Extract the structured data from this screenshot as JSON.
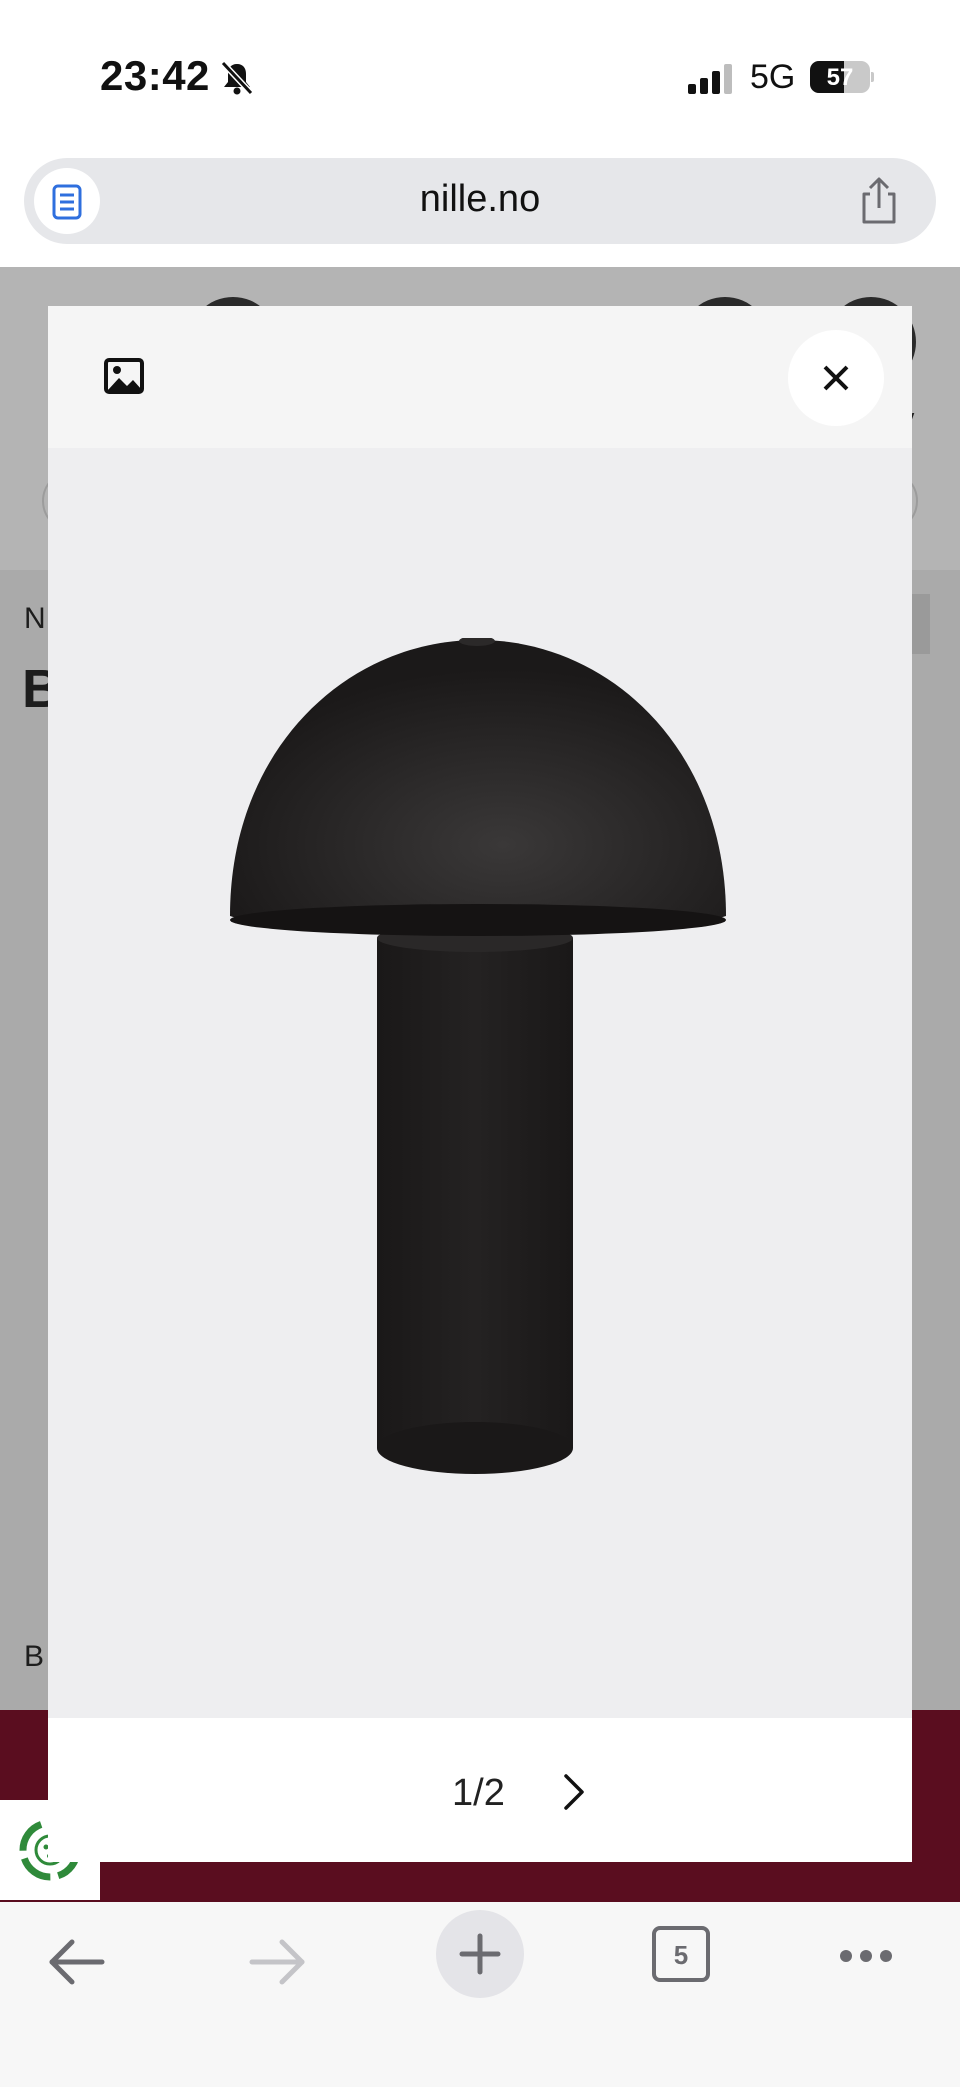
{
  "status_bar": {
    "time": "23:42",
    "network": "5G",
    "battery": "57",
    "battery_level": 0.57
  },
  "browser": {
    "url": "nille.no",
    "tab_count": "5"
  },
  "background_page": {
    "crumb_fragment": "N",
    "title_fragment": "B",
    "text_fragment": "B",
    "nav_label_fragment": "rv"
  },
  "modal": {
    "pager": "1/2"
  },
  "colors": {
    "footer_band": "#5a0d1f",
    "eco_green": "#2f8a3a",
    "lamp": "#1e1c1c"
  },
  "icons": {
    "reader": "reader-icon",
    "share": "share-icon",
    "image": "image-icon",
    "close": "close-icon",
    "next": "chevron-right-icon",
    "back": "arrow-left-icon",
    "forward": "arrow-right-icon",
    "new_tab": "plus-icon",
    "tabs": "tabs-icon",
    "more": "more-icon",
    "silent": "bell-slash-icon",
    "signal": "signal-icon",
    "battery": "battery-icon",
    "eco": "recycle-icon"
  }
}
